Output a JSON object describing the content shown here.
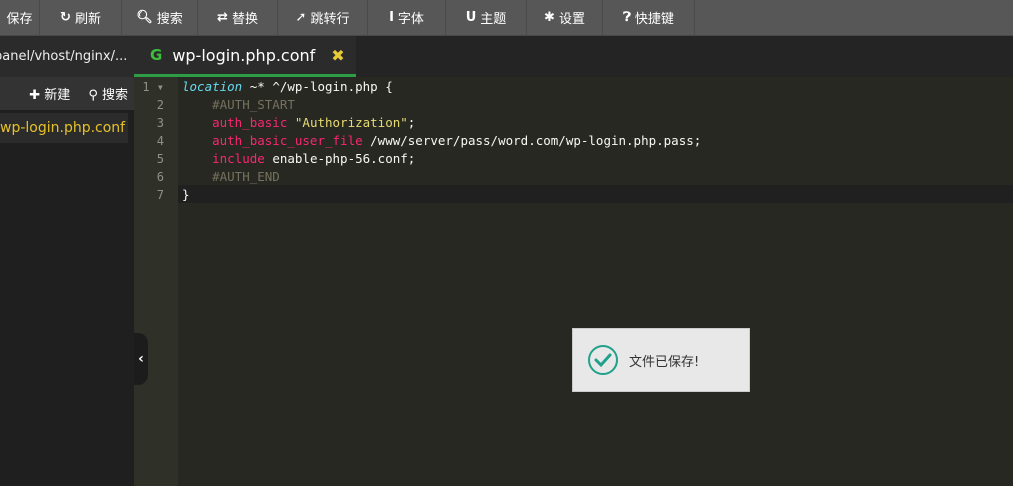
{
  "toolbar": {
    "items": [
      {
        "icon": "",
        "label": "保存"
      },
      {
        "icon": "↻",
        "label": "刷新"
      },
      {
        "icon": "🔍︎",
        "label": "搜索"
      },
      {
        "icon": "⇄",
        "label": "替换"
      },
      {
        "icon": "➚",
        "label": "跳转行"
      },
      {
        "icon": "I",
        "label": "字体"
      },
      {
        "icon": "U",
        "label": "主题"
      },
      {
        "icon": "✱",
        "label": "设置"
      },
      {
        "icon": "❓︎",
        "label": "快捷键"
      }
    ]
  },
  "path": "panel/vhost/nginx/...",
  "tab": {
    "title": "wp-login.php.conf",
    "icon": "G",
    "close": "✖"
  },
  "sidebar": {
    "new_label": "新建",
    "search_label": "搜索",
    "file": "wp-login.php.conf"
  },
  "editor": {
    "lines": [
      [
        {
          "t": "kw",
          "v": "location"
        },
        {
          "t": "op",
          "v": " ~* ^/wp-login.php {"
        }
      ],
      [
        {
          "t": "cm",
          "v": "    #AUTH_START"
        }
      ],
      [
        {
          "t": "pk",
          "v": "    auth_basic"
        },
        {
          "t": "op",
          "v": " "
        },
        {
          "t": "st",
          "v": "\"Authorization\""
        },
        {
          "t": "op",
          "v": ";"
        }
      ],
      [
        {
          "t": "pk",
          "v": "    auth_basic_user_file"
        },
        {
          "t": "op",
          "v": " /www/server/pass/word.com/wp-login.php.pass;"
        }
      ],
      [
        {
          "t": "pk",
          "v": "    include"
        },
        {
          "t": "op",
          "v": " enable-php-56.conf;"
        }
      ],
      [
        {
          "t": "cm",
          "v": "    #AUTH_END"
        }
      ],
      [
        {
          "t": "op",
          "v": "}"
        }
      ]
    ]
  },
  "toast": {
    "message": "文件已保存!"
  }
}
